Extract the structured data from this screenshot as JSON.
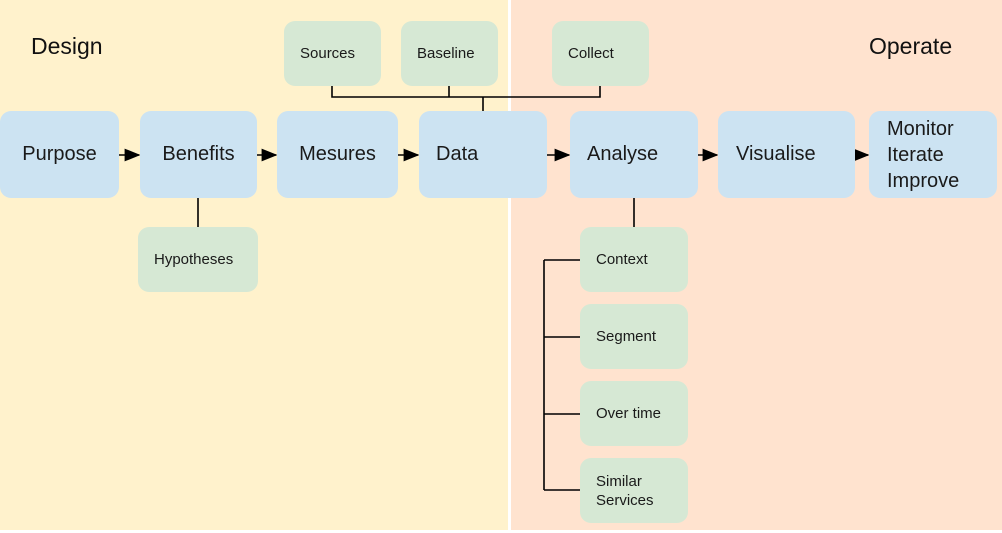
{
  "zones": {
    "design": {
      "label": "Design",
      "color": "#fff2cc"
    },
    "operate": {
      "label": "Operate",
      "color": "#ffe3cf"
    }
  },
  "steps": [
    "Purpose",
    "Benefits",
    "Mesures",
    "Data",
    "Analyse",
    "Visualise",
    "Monitor\nIterate\nImprove"
  ],
  "data_inputs": [
    "Sources",
    "Baseline",
    "Collect"
  ],
  "benefits_sub": "Hypotheses",
  "analyse_subs": [
    "Context",
    "Segment",
    "Over time",
    "Similar\nServices"
  ]
}
